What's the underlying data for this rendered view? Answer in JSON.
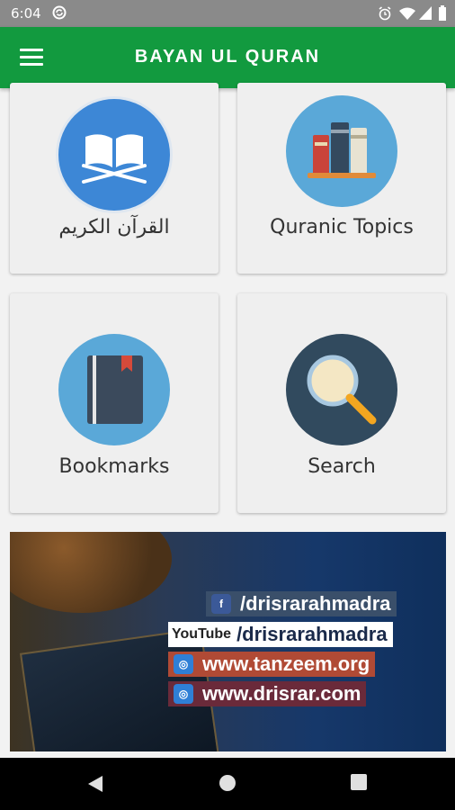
{
  "status_bar": {
    "time": "6:04",
    "icons": [
      "sync-icon",
      "alarm-icon",
      "wifi-icon",
      "signal-icon",
      "battery-icon"
    ]
  },
  "app_bar": {
    "title": "BAYAN UL QURAN",
    "menu_icon": "hamburger-menu-icon",
    "background": "#129a3f"
  },
  "tiles": [
    {
      "label": "القرآن الكريم",
      "icon": "open-quran-book-icon",
      "color": "#3d87d6"
    },
    {
      "label": "Quranic Topics",
      "icon": "books-shelf-icon",
      "color": "#5aa8d8"
    },
    {
      "label": "Bookmarks",
      "icon": "bookmarked-book-icon",
      "color": "#5aa8d8"
    },
    {
      "label": "Search",
      "icon": "magnifier-icon",
      "color": "#314a5e"
    }
  ],
  "banner": {
    "lines": [
      {
        "icon": "facebook-icon",
        "text": "/drisrarahmadra"
      },
      {
        "icon": "youtube-icon",
        "prefix": "YouTube",
        "text": "/drisrarahmadra"
      },
      {
        "icon": "globe-icon",
        "text": "www.tanzeem.org"
      },
      {
        "icon": "globe-icon",
        "text": "www.drisrar.com"
      }
    ]
  },
  "nav_bar": {
    "buttons": [
      "back-icon",
      "home-icon",
      "recents-icon"
    ]
  }
}
